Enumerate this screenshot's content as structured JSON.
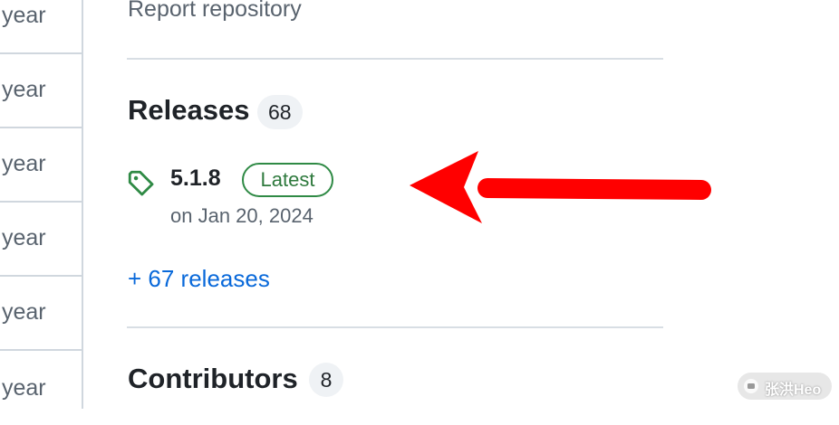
{
  "left_column": {
    "rows": [
      "year",
      "year",
      "year",
      "year",
      "year",
      "year"
    ]
  },
  "report": {
    "label": "Report repository"
  },
  "releases": {
    "title": "Releases",
    "count": "68",
    "latest": {
      "version": "5.1.8",
      "badge": "Latest",
      "date": "on Jan 20, 2024",
      "icon": "tag-icon"
    },
    "more_link": "+ 67 releases"
  },
  "contributors": {
    "title": "Contributors",
    "count": "8"
  },
  "annotation": {
    "arrow_color": "#ff0000"
  },
  "watermark": {
    "text": "张洪Heo"
  },
  "colors": {
    "link": "#0969da",
    "badge_green": "#2f8a45",
    "muted": "#59636e",
    "divider": "#d8dee4"
  }
}
